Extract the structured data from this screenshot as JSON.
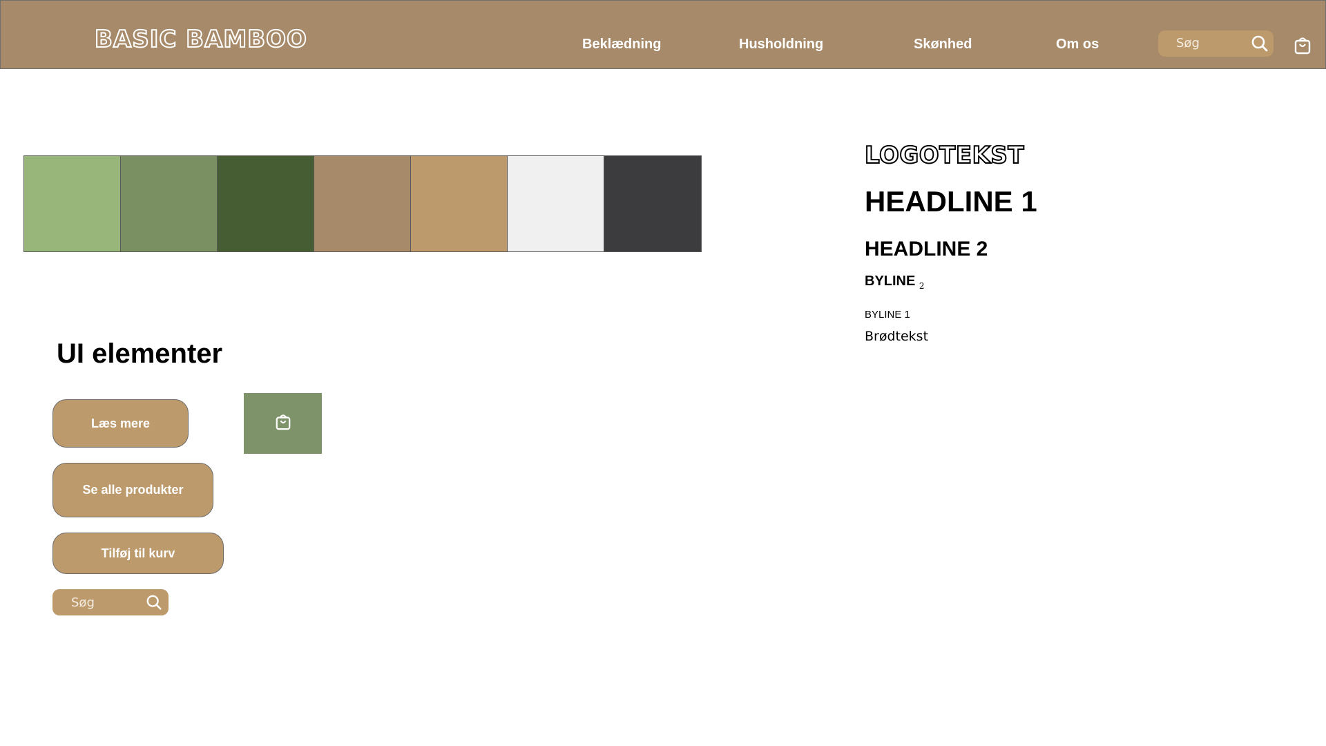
{
  "header": {
    "logo": "BASIC BAMBOO",
    "nav": [
      {
        "label": "Beklædning"
      },
      {
        "label": "Husholdning"
      },
      {
        "label": "Skønhed"
      },
      {
        "label": "Om os"
      }
    ],
    "search": {
      "placeholder": "Søg",
      "icon": "search-icon"
    },
    "cart_icon": "cart-icon"
  },
  "palette": {
    "colors": [
      "#98b57a",
      "#7a8f62",
      "#465c32",
      "#a68a69",
      "#bc9a6c",
      "#f0f0f0",
      "#3c3b3d"
    ]
  },
  "typography": {
    "logo_text": "LOGOTEKST",
    "headline1": "HEADLINE 1",
    "headline2": "HEADLINE 2",
    "byline2": "BYLINE",
    "byline2_sub": "2",
    "byline1": "BYLINE 1",
    "body": "Brødtekst"
  },
  "ui": {
    "heading": "UI elementer",
    "buttons": [
      {
        "label": "Læs mere"
      },
      {
        "label": "Se alle produkter"
      },
      {
        "label": "Tilføj til kurv"
      }
    ],
    "cart_tile_icon": "cart-icon",
    "search": {
      "placeholder": "Søg",
      "icon": "search-icon"
    }
  },
  "colors": {
    "header_bg": "#a78a69",
    "button_bg": "#bc9a6c",
    "accent_green": "#7f936a",
    "text_dark": "#000000"
  }
}
